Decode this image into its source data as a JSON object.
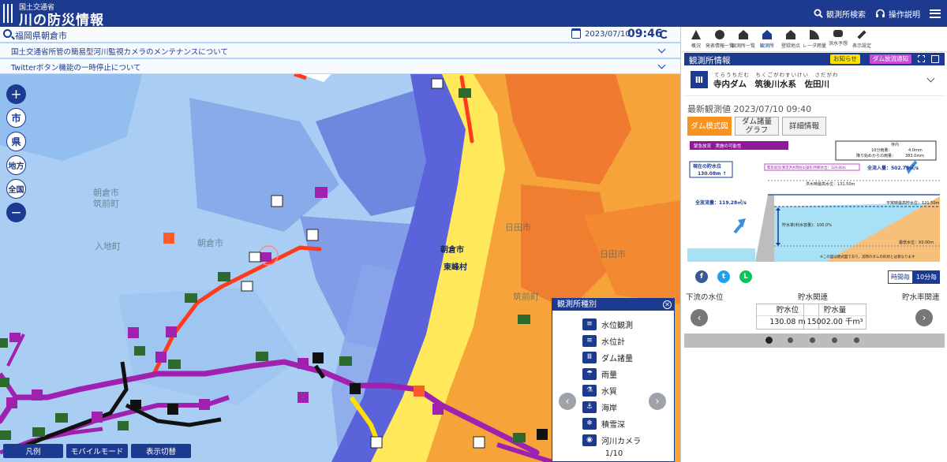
{
  "header": {
    "org": "国土交通省",
    "title": "川の防災情報",
    "station_search_label": "観測所検索",
    "help_label": "操作説明"
  },
  "map": {
    "location": "福岡県朝倉市",
    "date": "2023/07/10",
    "time": "09:46",
    "notices": [
      "国土交通省所管の簡易型河川監視カメラのメンテナンスについて",
      "Twitterボタン機能の一時停止について"
    ],
    "zoom_controls": [
      "市",
      "県",
      "地方",
      "全国"
    ],
    "place_labels": [
      "朝倉市",
      "東峰村"
    ],
    "bottom_buttons": [
      "凡例",
      "モバイルモード",
      "表示切替"
    ]
  },
  "legend": {
    "title": "観測所種別",
    "items": [
      {
        "label": "水位観測",
        "icon": "water-level-station-icon",
        "glyph": "≡"
      },
      {
        "label": "水位計",
        "icon": "water-gauge-icon",
        "glyph": "≡"
      },
      {
        "label": "ダム諸量",
        "icon": "dam-icon",
        "glyph": "Ⅲ"
      },
      {
        "label": "雨量",
        "icon": "umbrella-icon",
        "glyph": "☂"
      },
      {
        "label": "水質",
        "icon": "flask-icon",
        "glyph": "⚗"
      },
      {
        "label": "海岸",
        "icon": "anchor-icon",
        "glyph": "⚓"
      },
      {
        "label": "積雪深",
        "icon": "snowflake-icon",
        "glyph": "❄"
      },
      {
        "label": "河川カメラ",
        "icon": "camera-icon",
        "glyph": "◉"
      }
    ],
    "page": "1/10"
  },
  "panel": {
    "tabs": [
      {
        "label": "概況",
        "icon": "warning-icon"
      },
      {
        "label": "発表情報一覧",
        "icon": "alert-circle-icon"
      },
      {
        "label": "観測所一覧",
        "icon": "building-icon"
      },
      {
        "label": "観測所",
        "icon": "station-house-icon",
        "active": true
      },
      {
        "label": "登録地点",
        "icon": "home-icon"
      },
      {
        "label": "レーダ雨量",
        "icon": "radar-icon"
      },
      {
        "label": "洪水予想",
        "icon": "flood-waves-icon"
      },
      {
        "label": "表示設定",
        "icon": "wrench-icon"
      }
    ],
    "info_title": "観測所情報",
    "notice_pill": "お知らせ",
    "dam_release_pill": "ダム放流通知",
    "station_ruby": "てらうちだむ　ちくごがわすいけい　さだがわ",
    "station_name": "寺内ダム　筑後川水系　佐田川",
    "latest": "最新観測値 2023/07/10 09:40",
    "view_tabs": [
      "ダム模式図",
      "ダム諸量\nグラフ",
      "詳細情報"
    ],
    "diagram": {
      "emergency_label": "緊急放流　実施の可能性",
      "rain_title": "寺内",
      "rain_10min_label": "10分雨量：",
      "rain_10min_value": "4.0mm",
      "rain_total_label": "降り始めからの雨量：",
      "rain_total_value": "383.0mm",
      "current_level_label": "現在の貯水位",
      "current_level_value": "130.08m ↑",
      "emergency_level": "緊急放流(異常洪水時防災操作)判断水位：129.80m",
      "inflow": "全流入量：502.75㎥/s",
      "flood_level": "洪水時最高水位：131.50m",
      "outflow": "全放流量：119.28㎥/s",
      "normal_level": "平常時最高貯水位：121.50m",
      "storage_rate": "貯水率(利水容量)：100.0%",
      "min_level": "最低水位：93.00m",
      "note": "※この図は模式図であり、実際のダムの形状とは異なります"
    },
    "share_icons": [
      {
        "name": "facebook-icon",
        "glyph": "f",
        "color": "#3b5998"
      },
      {
        "name": "twitter-icon",
        "glyph": "t",
        "color": "#1da1f2"
      },
      {
        "name": "line-icon",
        "glyph": "L",
        "color": "#06c755"
      }
    ],
    "interval_options": [
      "時間毎",
      "10分毎"
    ],
    "sections": [
      "下流の水位",
      "貯水関連",
      "貯水率関連"
    ],
    "storage": [
      {
        "label": "貯水位",
        "value": "130.08 m"
      },
      {
        "label": "貯水量",
        "value": "15002.00 千m³"
      }
    ],
    "dots": 5
  },
  "colors": {
    "brand": "#1c3a8f",
    "accent": "#f7931e",
    "dam_pill": "#c74fd3",
    "notice_pill": "#ffe100"
  }
}
